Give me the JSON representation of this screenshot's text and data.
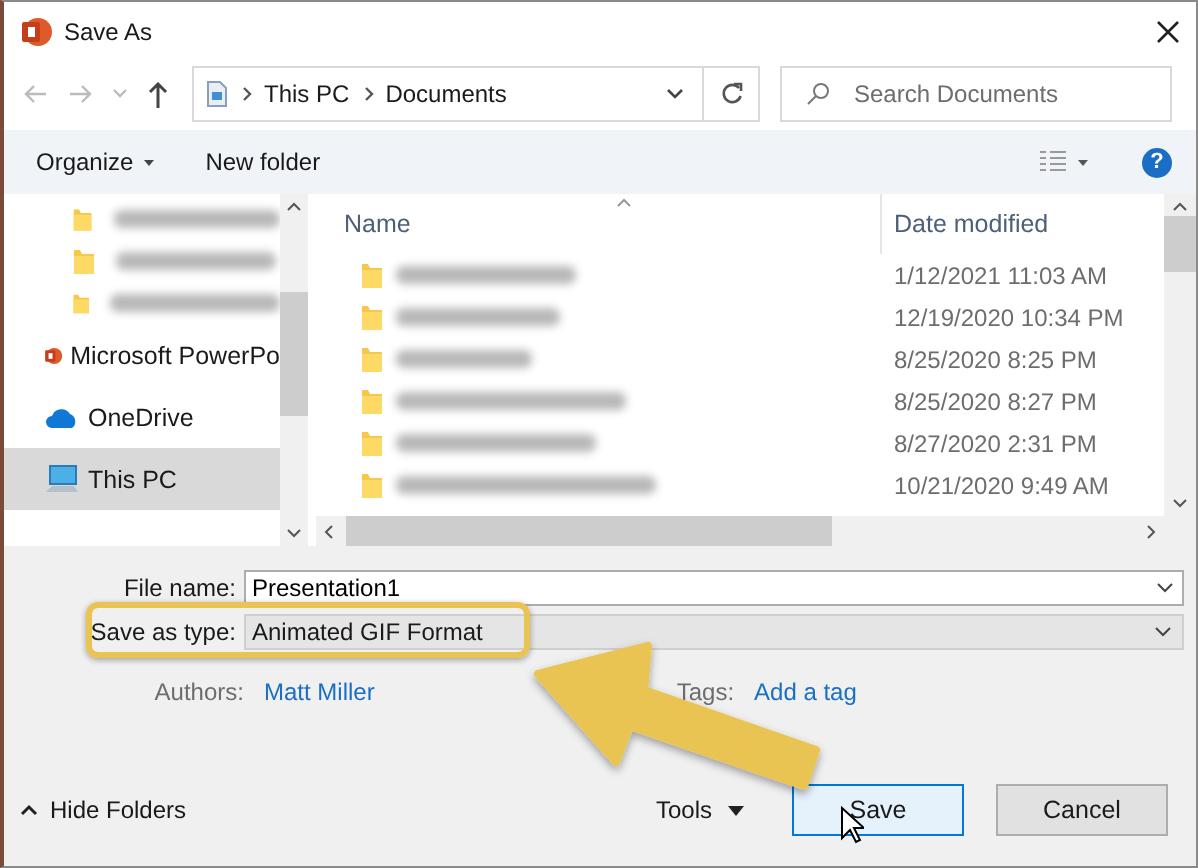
{
  "window": {
    "title": "Save As"
  },
  "address": {
    "crumbs": [
      "This PC",
      "Documents"
    ]
  },
  "search": {
    "placeholder": "Search Documents"
  },
  "toolbar": {
    "organize": "Organize",
    "new_folder": "New folder",
    "help": "?"
  },
  "sidebar": {
    "items": [
      {
        "kind": "blurred-folder",
        "selected": false
      },
      {
        "kind": "blurred-folder",
        "selected": false
      },
      {
        "kind": "blurred-folder",
        "selected": false
      },
      {
        "kind": "powerpoint",
        "label": "Microsoft PowerPo",
        "selected": false
      },
      {
        "kind": "onedrive",
        "label": "OneDrive",
        "selected": false
      },
      {
        "kind": "pc",
        "label": "This PC",
        "selected": true
      }
    ]
  },
  "file_list": {
    "columns": [
      "Name",
      "Date modified"
    ],
    "rows": [
      {
        "kind": "folder",
        "date_modified": "1/12/2021 11:03 AM"
      },
      {
        "kind": "folder",
        "date_modified": "12/19/2020 10:34 PM"
      },
      {
        "kind": "folder",
        "date_modified": "8/25/2020 8:25 PM"
      },
      {
        "kind": "folder",
        "date_modified": "8/25/2020 8:27 PM"
      },
      {
        "kind": "folder",
        "date_modified": "8/27/2020 2:31 PM"
      },
      {
        "kind": "folder",
        "date_modified": "10/21/2020 9:49 AM"
      }
    ]
  },
  "form": {
    "file_name_label": "File name:",
    "file_name": "Presentation1",
    "type_label": "Save as type:",
    "type": "Animated GIF Format",
    "authors_label": "Authors:",
    "author": "Matt Miller",
    "tags_label": "Tags:",
    "tags": "Add a tag"
  },
  "footer": {
    "hide_folders": "Hide Folders",
    "tools": "Tools",
    "buttons": [
      {
        "label": "Save",
        "kind": "primary"
      },
      {
        "label": "Cancel",
        "kind": "secondary"
      }
    ]
  }
}
